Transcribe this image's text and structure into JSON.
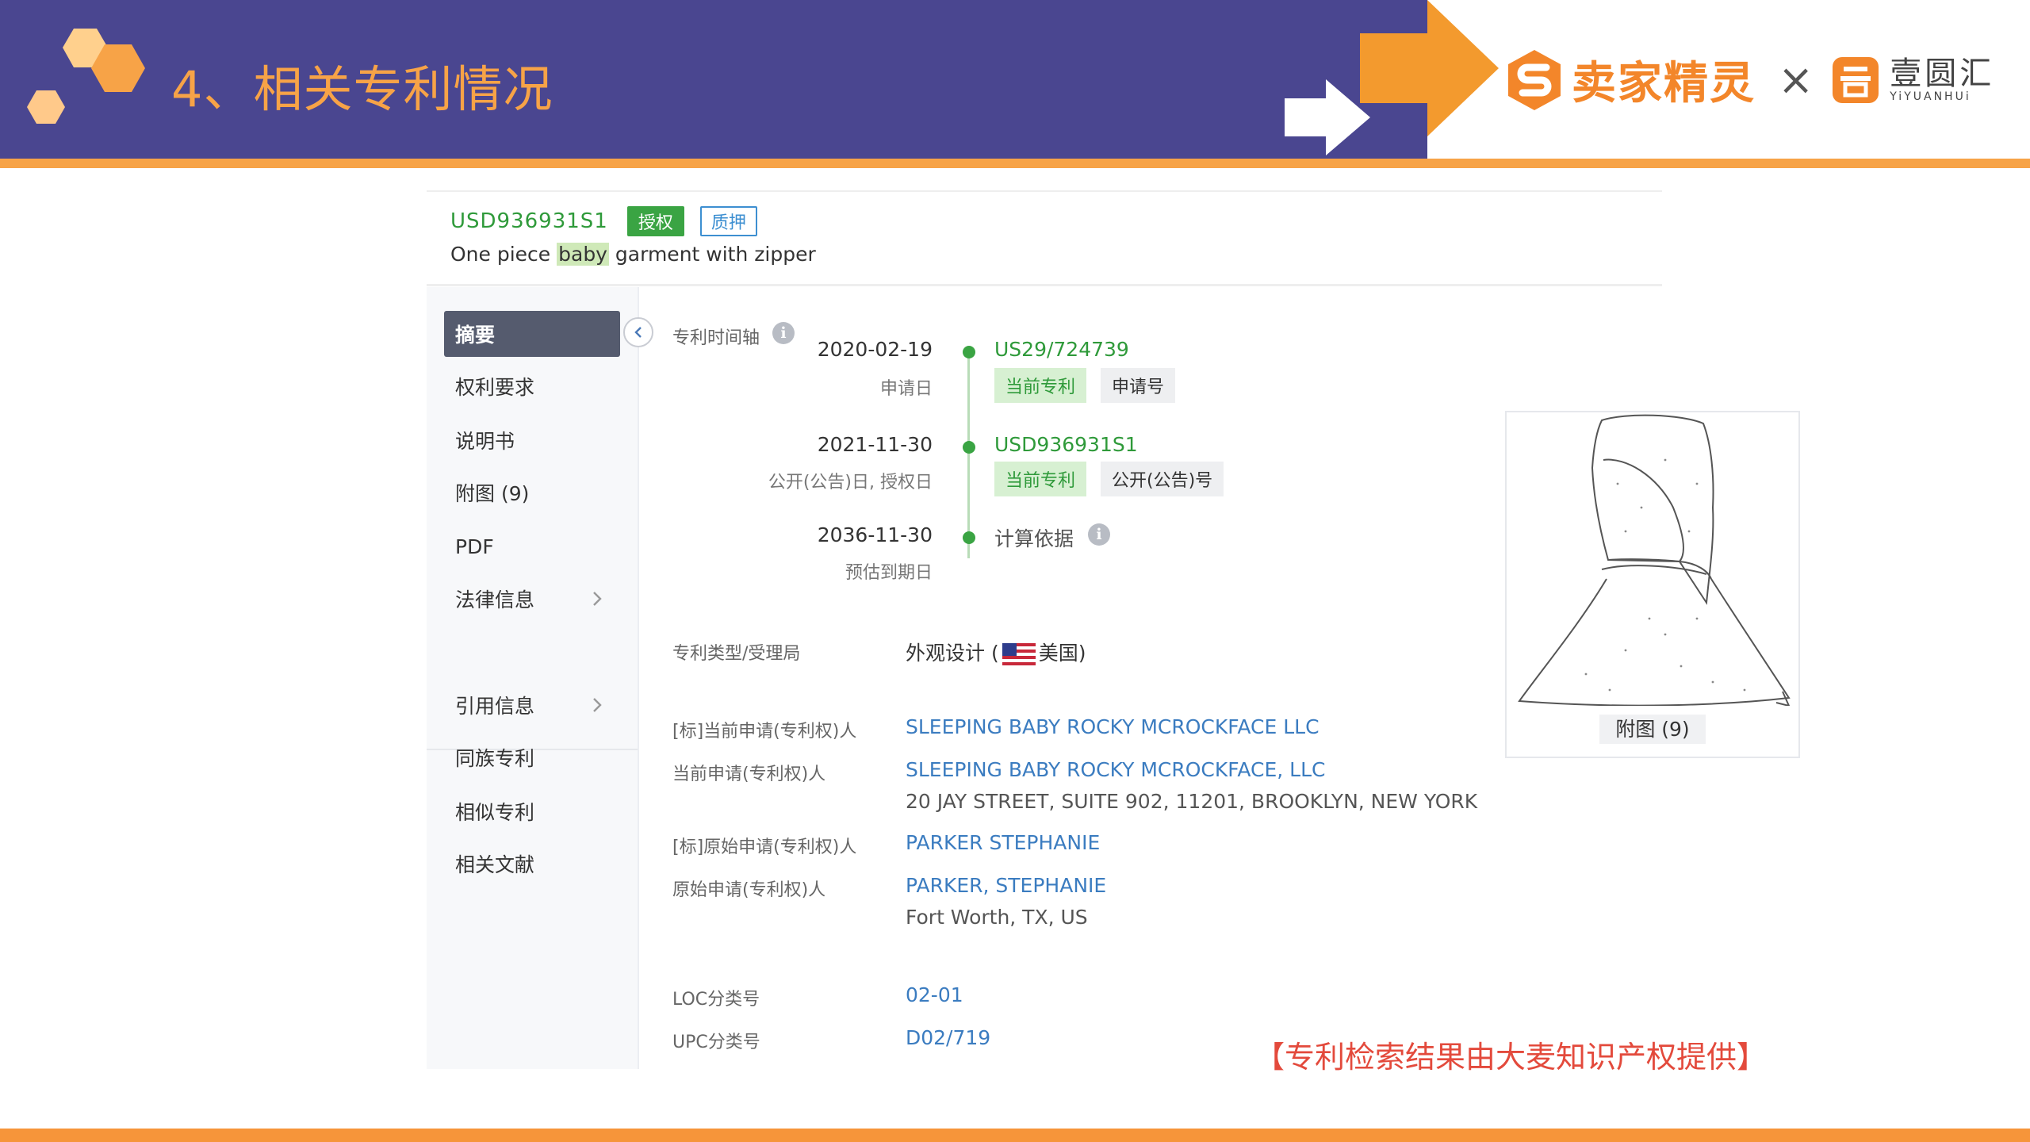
{
  "slide": {
    "title": "4、相关专利情况",
    "brand_name": "卖家精灵",
    "brand_x": "×",
    "brand2_cn": "壹圆汇",
    "brand2_en": "YiYUANHUi",
    "source_note": "【专利检索结果由大麦知识产权提供】",
    "colors": {
      "header": "#4a4690",
      "accent": "#f7a347",
      "brand": "#f3862a"
    }
  },
  "patent": {
    "number": "USD936931S1",
    "badge_grant": "授权",
    "badge_pledge": "质押",
    "title_before": "One piece ",
    "title_highlight": "baby",
    "title_after": " garment with zipper"
  },
  "sidebar": {
    "items": [
      {
        "label": "摘要"
      },
      {
        "label": "权利要求"
      },
      {
        "label": "说明书"
      },
      {
        "label": "附图 (9)"
      },
      {
        "label": "PDF"
      },
      {
        "label": "法律信息"
      },
      {
        "label": "引用信息"
      },
      {
        "label": "同族专利"
      },
      {
        "label": "相似专利"
      },
      {
        "label": "相关文献"
      }
    ]
  },
  "timeline": {
    "heading": "专利时间轴",
    "events": [
      {
        "date": "2020-02-19",
        "sub": "申请日",
        "value": "US29/724739",
        "tag_current": "当前专利",
        "tag_other": "申请号"
      },
      {
        "date": "2021-11-30",
        "sub": "公开(公告)日, 授权日",
        "value": "USD936931S1",
        "tag_current": "当前专利",
        "tag_other": "公开(公告)号"
      },
      {
        "date": "2036-11-30",
        "sub": "预估到期日",
        "value": "计算依据"
      }
    ]
  },
  "details": {
    "type_label": "专利类型/受理局",
    "type_value_before": "外观设计 (",
    "type_value_after": "美国)",
    "cur_std_label": "[标]当前申请(专利权)人",
    "cur_std_value": "SLEEPING BABY ROCKY MCROCKFACE LLC",
    "cur_label": "当前申请(专利权)人",
    "cur_value": "SLEEPING BABY ROCKY MCROCKFACE, LLC",
    "cur_address": "20 JAY STREET, SUITE 902, 11201, BROOKLYN, NEW YORK",
    "orig_std_label": "[标]原始申请(专利权)人",
    "orig_std_value": "PARKER STEPHANIE",
    "orig_label": "原始申请(专利权)人",
    "orig_value": "PARKER, STEPHANIE",
    "orig_address": "Fort Worth, TX, US",
    "loc_label": "LOC分类号",
    "loc_value": "02-01",
    "upc_label": "UPC分类号",
    "upc_value": "D02/719"
  },
  "drawing": {
    "caption": "附图 (9)"
  }
}
